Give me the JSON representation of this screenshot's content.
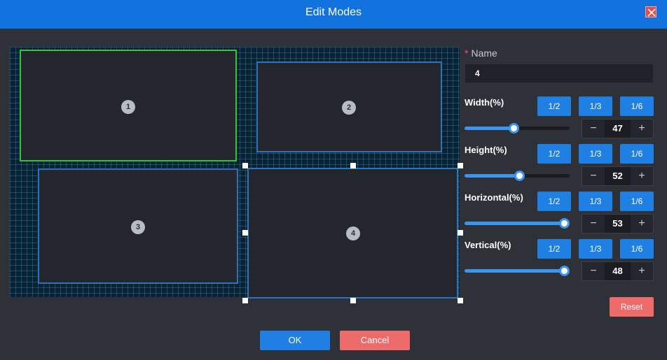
{
  "dialog": {
    "title": "Edit Modes"
  },
  "layout": {
    "windows": [
      {
        "label": "1",
        "selected": true
      },
      {
        "label": "2",
        "selected": false
      },
      {
        "label": "3",
        "selected": false
      },
      {
        "label": "4",
        "selected": false
      }
    ]
  },
  "form": {
    "name_required_mark": "*",
    "name_label": "Name",
    "name_value": "4",
    "fraction_labels": [
      "1/2",
      "1/3",
      "1/6"
    ],
    "width": {
      "label": "Width(%)",
      "value": "47",
      "percent": 47
    },
    "height": {
      "label": "Height(%)",
      "value": "52",
      "percent": 52
    },
    "horizontal": {
      "label": "Horizontal(%)",
      "value": "53",
      "percent": 100
    },
    "vertical": {
      "label": "Vertical(%)",
      "value": "48",
      "percent": 100
    },
    "minus_symbol": "−",
    "plus_symbol": "+",
    "reset_label": "Reset"
  },
  "footer": {
    "ok_label": "OK",
    "cancel_label": "Cancel"
  },
  "colors": {
    "accent": "#1f7fe2",
    "danger": "#ed6b6b",
    "selected_border": "#2fc534",
    "window_border": "#2c73bf"
  }
}
